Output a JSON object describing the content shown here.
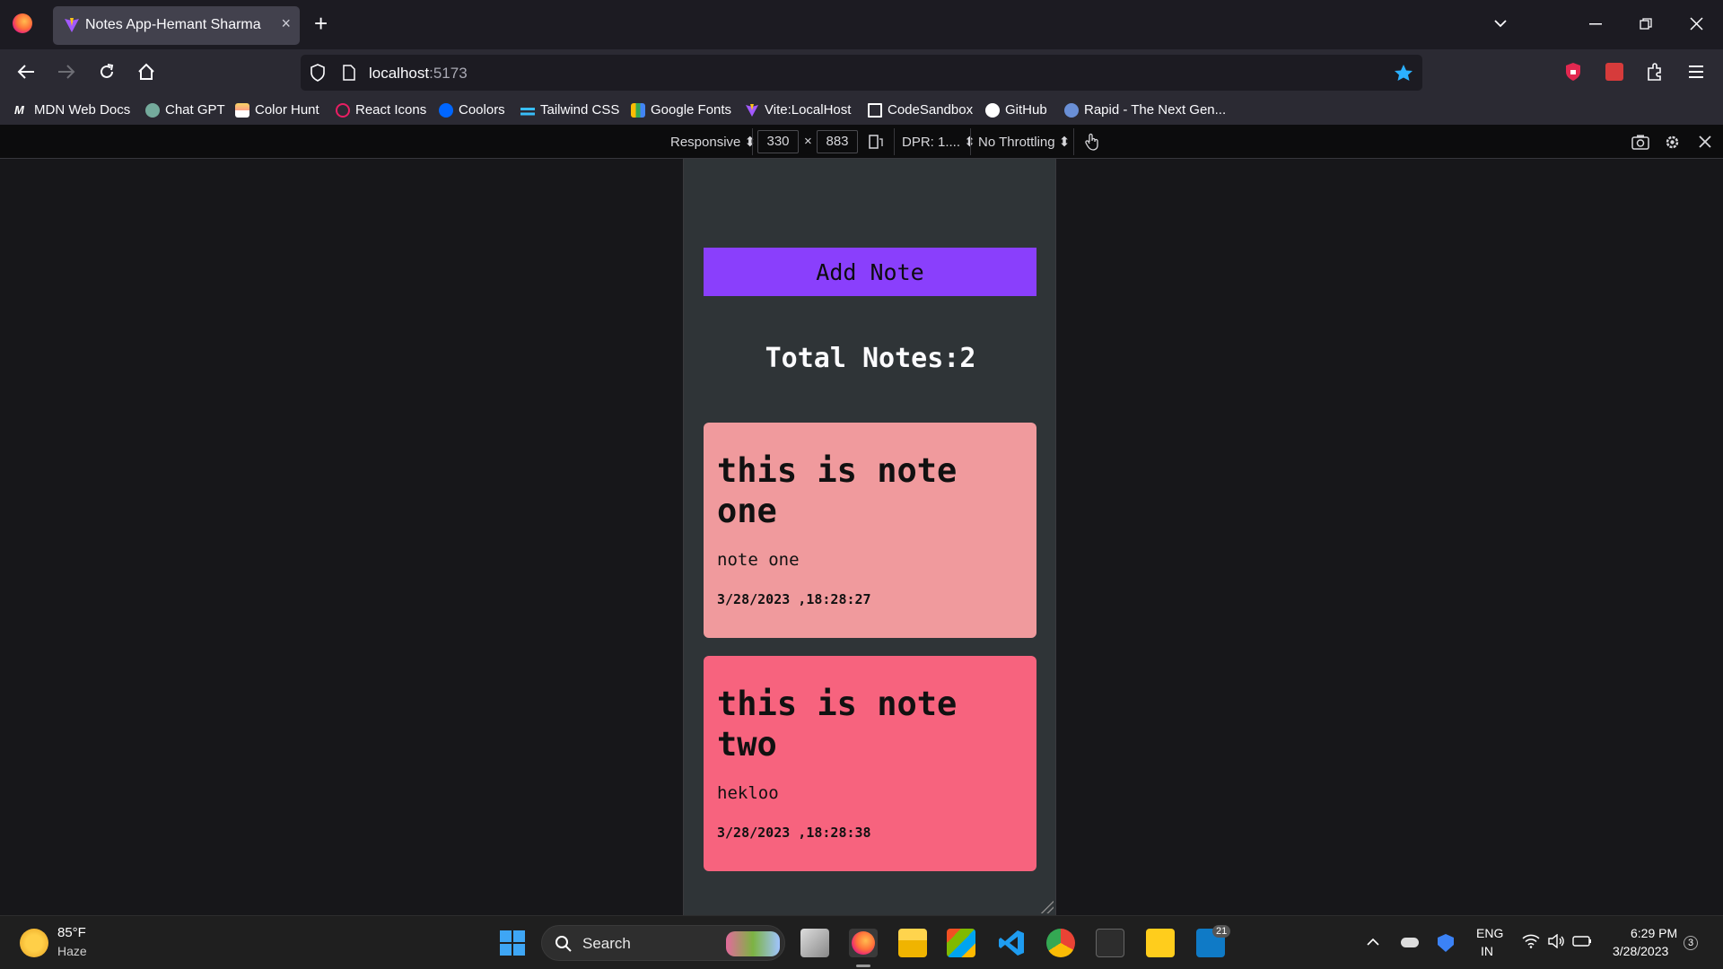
{
  "browser": {
    "tab_title": "Notes App-Hemant Sharma",
    "tab_close": "×",
    "new_tab": "+",
    "url_host": "localhost",
    "url_port": ":5173",
    "bookmarks": [
      "MDN Web Docs",
      "Chat GPT",
      "Color Hunt",
      "React Icons",
      "Coolors",
      "Tailwind CSS",
      "Google Fonts",
      "Vite:LocalHost",
      "CodeSandbox",
      "GitHub",
      "Rapid - The Next Gen..."
    ]
  },
  "rdm": {
    "device": "Responsive",
    "width": "330",
    "times": "×",
    "height": "883",
    "dpr": "DPR: 1....",
    "throttling": "No Throttling"
  },
  "app": {
    "add_label": "Add Note",
    "total_label": "Total Notes:2",
    "accent": "#8a3ffc",
    "notes": [
      {
        "title": "this is note one",
        "body": "note one",
        "time": "3/28/2023 ,18:28:27",
        "color": "#f09a9d"
      },
      {
        "title": "this is note two",
        "body": "hekloo",
        "time": "3/28/2023 ,18:28:38",
        "color": "#f7637e"
      }
    ]
  },
  "taskbar": {
    "weather_temp": "85°F",
    "weather_desc": "Haze",
    "search_label": "Search",
    "badge": "21",
    "lang": "ENG",
    "region": "IN",
    "time": "6:29 PM",
    "date": "3/28/2023",
    "notif_count": "3"
  }
}
